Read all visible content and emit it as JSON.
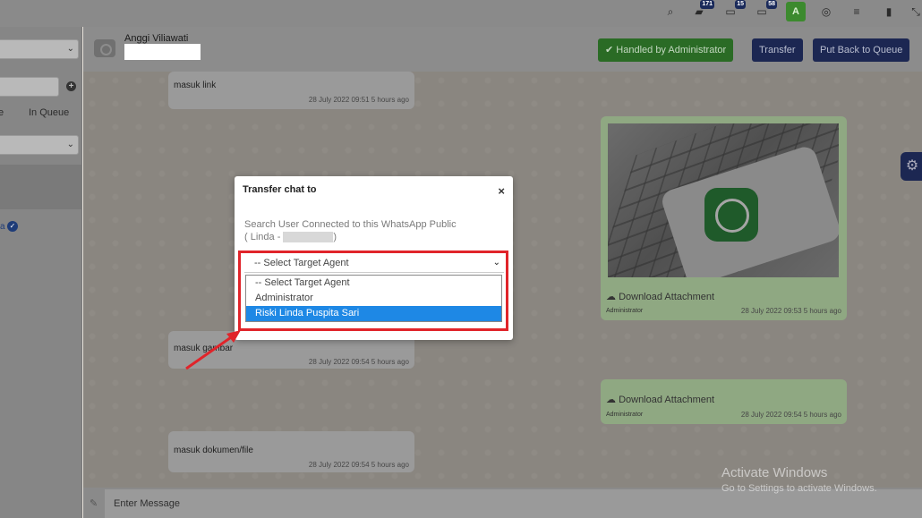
{
  "topbar": {
    "icons": [
      {
        "name": "search-icon",
        "glyph": "🔍"
      },
      {
        "name": "chat-icon",
        "glyph": "💬",
        "badge": "171"
      },
      {
        "name": "message-icon",
        "glyph": "▭",
        "badge": "15"
      },
      {
        "name": "inbox-icon",
        "glyph": "▭",
        "badge": "58"
      },
      {
        "name": "user-avatar-icon",
        "glyph": "A"
      },
      {
        "name": "globe-icon",
        "glyph": "◎"
      },
      {
        "name": "menu-icon",
        "glyph": "≡"
      },
      {
        "name": "bookmark-icon",
        "glyph": "▮"
      },
      {
        "name": "expand-icon",
        "glyph": "⤡"
      }
    ]
  },
  "sidebar": {
    "tab_partial": "e",
    "tab_in_queue": "In Queue",
    "check_label": "a"
  },
  "chat_header": {
    "contact_name": "Anggi Viliawati",
    "handled_label": "Handled by  Administrator",
    "transfer_label": "Transfer",
    "queue_label": "Put Back to Queue"
  },
  "messages": [
    {
      "text": "masuk link",
      "time": "28 July 2022 09:51 5 hours ago"
    },
    {
      "text": "masuk gambar",
      "time": "28 July 2022 09:54 5 hours ago"
    },
    {
      "text": "masuk dokumen/file",
      "time": "28 July 2022 09:54 5 hours ago"
    }
  ],
  "outgoing": [
    {
      "download": "Download Attachment",
      "sender": "Administrator",
      "time": "28 July 2022 09:53 5 hours ago"
    },
    {
      "download": "Download Attachment",
      "sender": "Administrator",
      "time": "28 July 2022 09:54 5 hours ago"
    }
  ],
  "input": {
    "placeholder": "Enter Message"
  },
  "watermark": {
    "line1": "Activate Windows",
    "line2": "Go to Settings to activate Windows."
  },
  "modal": {
    "title": "Transfer chat to",
    "close": "×",
    "desc_line1": "Search User Connected to this WhatsApp Public",
    "desc_prefix": "( Linda - ",
    "desc_suffix": ")",
    "select_value": "-- Select Target Agent",
    "options": [
      "-- Select Target Agent",
      "Administrator",
      "Riski Linda Puspita Sari"
    ],
    "selected_index": 2
  },
  "colors": {
    "accent_blue": "#1e88e5",
    "highlight_red": "#e0242a",
    "handled_green": "#2a6b25",
    "navy": "#1c2752"
  }
}
